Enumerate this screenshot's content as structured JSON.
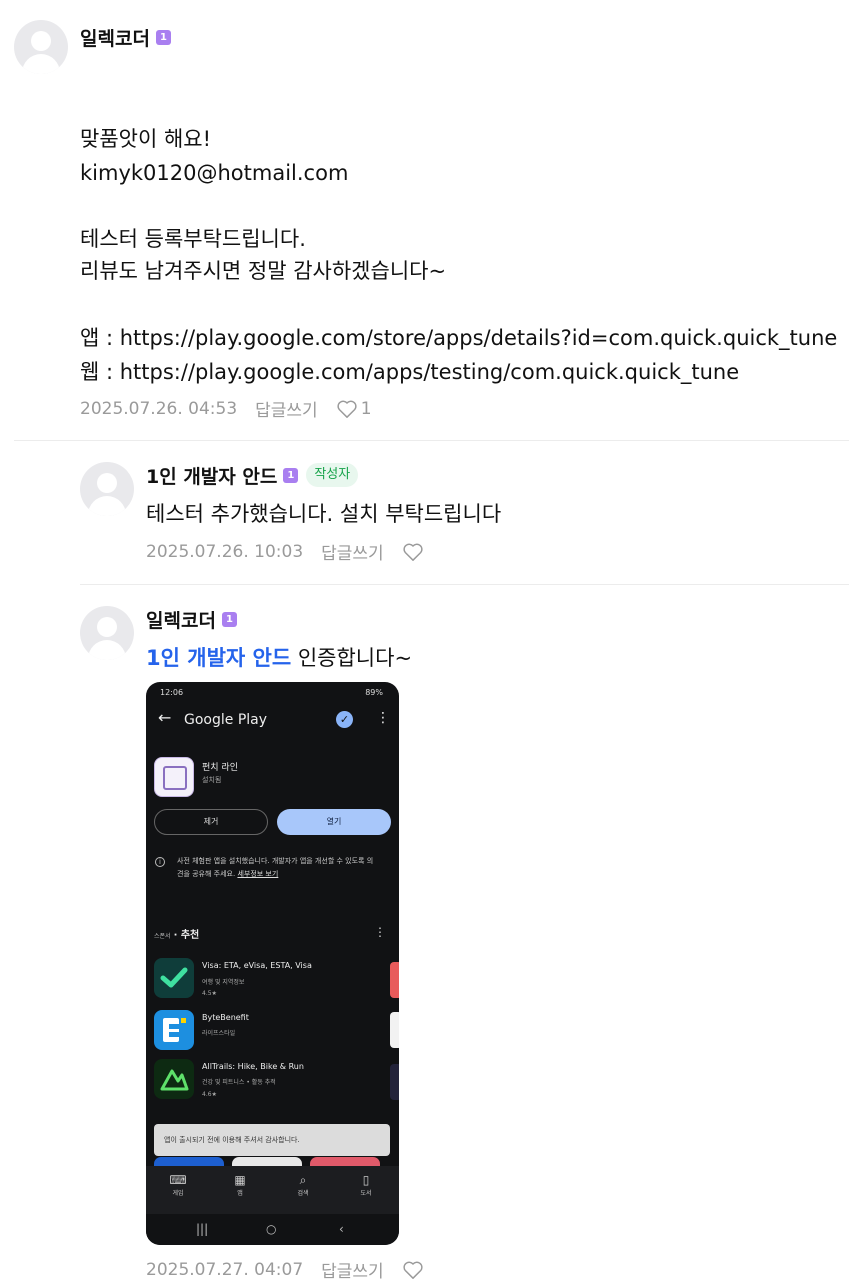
{
  "comments": [
    {
      "nickname": "일렉코더",
      "level": "1",
      "lines": [
        "맞품앗이 해요!",
        "kimyk0120@hotmail.com",
        "",
        "테스터 등록부탁드립니다.",
        "리뷰도 남겨주시면 정말 감사하겠습니다~",
        "",
        "앱 : https://play.google.com/store/apps/details?id=com.quick.quick_tune",
        "웹 : https://play.google.com/apps/testing/com.quick.quick_tune"
      ],
      "date": "2025.07.26. 04:53",
      "reply_label": "답글쓰기",
      "like_count": "1"
    },
    {
      "nickname": "1인 개발자 안드",
      "level": "1",
      "author_badge": "작성자",
      "text": "테스터 추가했습니다. 설치 부탁드립니다",
      "date": "2025.07.26. 10:03",
      "reply_label": "답글쓰기"
    },
    {
      "nickname": "일렉코더",
      "level": "1",
      "mention": "1인 개발자 안드",
      "text": "인증합니다~",
      "date": "2025.07.27. 04:07",
      "reply_label": "답글쓰기",
      "attachment": {
        "status_time": "12:06",
        "status_right": "89%",
        "store_title": "Google Play",
        "app_name": "펀치 라인",
        "app_sub": "설치됨",
        "remove_label": "제거",
        "open_label": "열기",
        "notice": "사전 체험판 앱을 설치했습니다. 개발자가 앱을 개선할 수 있도록 의견을 공유해 주세요.",
        "notice_link": "세부정보 보기",
        "section_tag": "스폰서",
        "section_title": "추천",
        "apps": [
          {
            "title": "Visa: ETA, eVisa, ESTA, Visa",
            "category": "여행 및 지역정보",
            "rating": "4.5★"
          },
          {
            "title": "ByteBenefit",
            "category": "라이프스타일",
            "rating": ""
          },
          {
            "title": "AllTrails: Hike, Bike & Run",
            "category": "건강 및 피트니스 • 활동 추적",
            "rating": "4.6★"
          }
        ],
        "toast": "앱이 출시되기 전에 이용해 주셔서 감사합니다.",
        "nav": [
          "게임",
          "앱",
          "검색",
          "도서"
        ],
        "colors": {
          "accent": "#a8c7fa",
          "visa": "#0f3d3a",
          "byte": "#1d8fe0",
          "alltrails": "#0d2a12"
        }
      }
    }
  ]
}
